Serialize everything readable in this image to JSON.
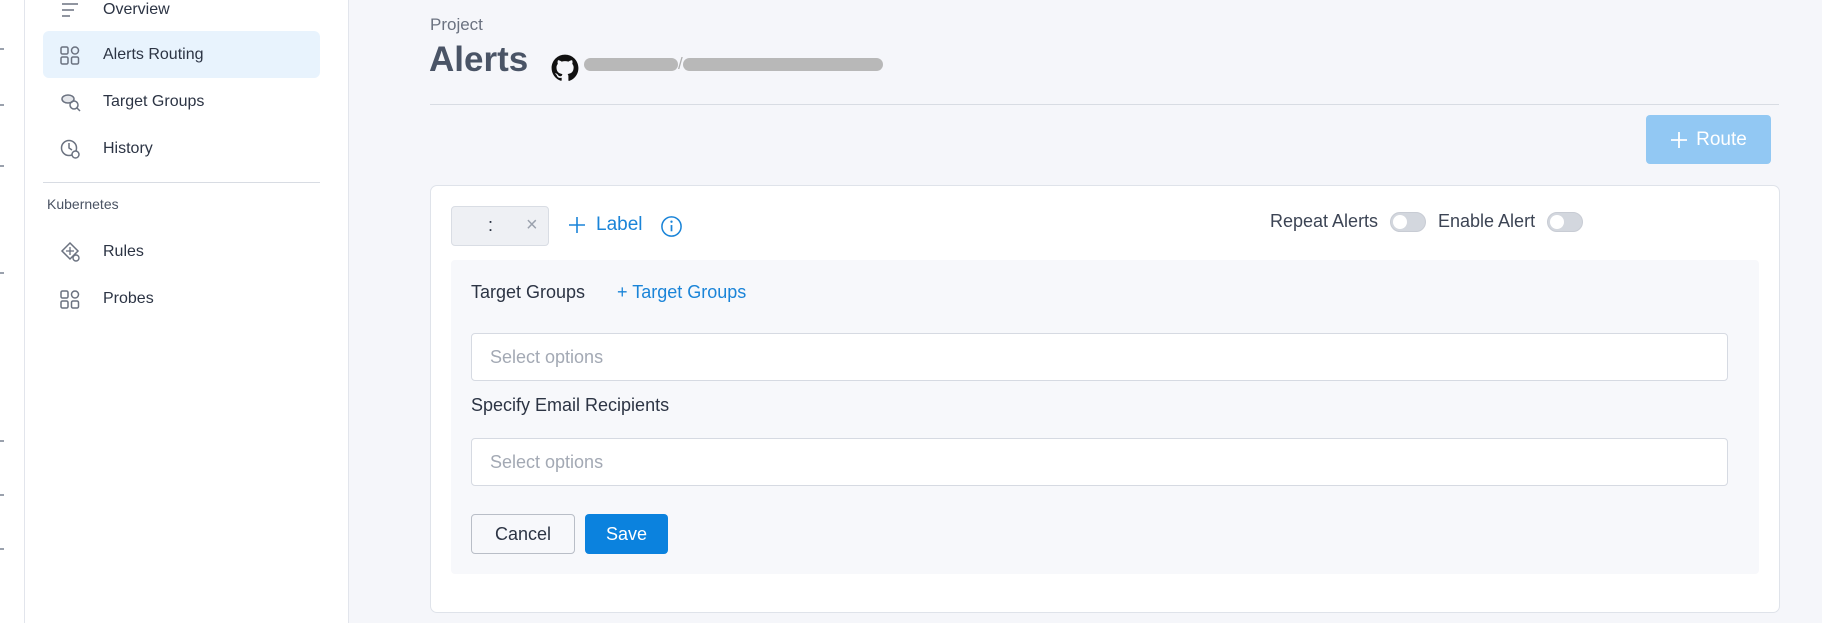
{
  "sidebar": {
    "items": [
      {
        "label": "Overview",
        "icon": "list-icon"
      },
      {
        "label": "Alerts Routing",
        "icon": "routing-icon"
      },
      {
        "label": "Target Groups",
        "icon": "target-groups-icon"
      },
      {
        "label": "History",
        "icon": "history-icon"
      }
    ],
    "section_label": "Kubernetes",
    "k8s_items": [
      {
        "label": "Rules",
        "icon": "rules-icon"
      },
      {
        "label": "Probes",
        "icon": "probes-icon"
      }
    ]
  },
  "header": {
    "breadcrumb": "Project",
    "title": "Alerts",
    "repo_visible": "/"
  },
  "toolbar": {
    "route_label": "Route"
  },
  "route_card": {
    "label_chip_separator": ":",
    "add_label": "Label",
    "repeat_alerts_label": "Repeat Alerts",
    "repeat_alerts_on": false,
    "enable_alert_label": "Enable Alert",
    "enable_alert_on": false,
    "target_groups_label": "Target Groups",
    "add_target_groups": "+ Target Groups",
    "target_groups_placeholder": "Select options",
    "email_label": "Specify Email Recipients",
    "email_placeholder": "Select options",
    "cancel_label": "Cancel",
    "save_label": "Save"
  },
  "colors": {
    "accent": "#0b82de",
    "link": "#1a84d8",
    "route_button": "#92c8f3",
    "active_nav_bg": "#e8f3fd"
  }
}
